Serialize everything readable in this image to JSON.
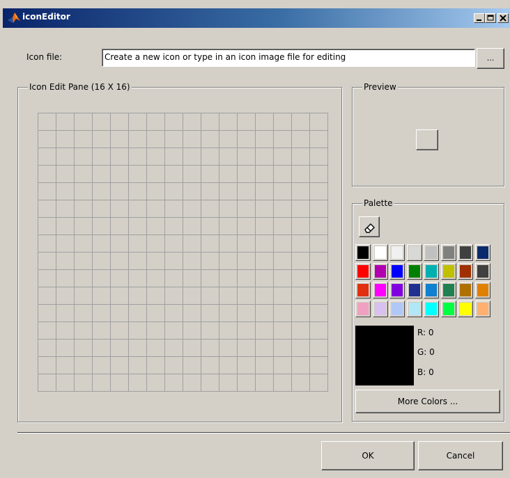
{
  "window": {
    "title": "iconEditor",
    "title_icon": "matlab-logo-icon",
    "controls": [
      "minimize-icon",
      "maximize-icon",
      "close-icon"
    ]
  },
  "icon_file": {
    "label": "Icon file:",
    "value": "Create a new icon or type in an icon image file for editing",
    "browse_label": "..."
  },
  "edit_pane": {
    "title": "Icon Edit Pane (16 X 16)",
    "rows": 16,
    "cols": 16
  },
  "preview": {
    "title": "Preview"
  },
  "palette": {
    "title": "Palette",
    "eraser_icon": "eraser-icon",
    "colors": [
      "#000000",
      "#ffffff",
      "#f0f0f0",
      "#d8d8d8",
      "#c0c0c0",
      "#808080",
      "#404040",
      "#0a2a6e",
      "#ff0000",
      "#b000b0",
      "#0000ff",
      "#008000",
      "#00b0b0",
      "#c0c000",
      "#a03000",
      "#404040",
      "#e03010",
      "#ff00ff",
      "#8000e0",
      "#203090",
      "#1080d0",
      "#208050",
      "#b07000",
      "#e08000",
      "#f0a0c0",
      "#d8c0f0",
      "#b0c8f8",
      "#b0e8f8",
      "#00ffff",
      "#00ff40",
      "#ffff00",
      "#ffb070"
    ],
    "current_color": "#000000",
    "r_label": "R: 0",
    "g_label": "G: 0",
    "b_label": "B: 0",
    "more_colors_label": "More Colors ..."
  },
  "buttons": {
    "ok_label": "OK",
    "cancel_label": "Cancel"
  }
}
